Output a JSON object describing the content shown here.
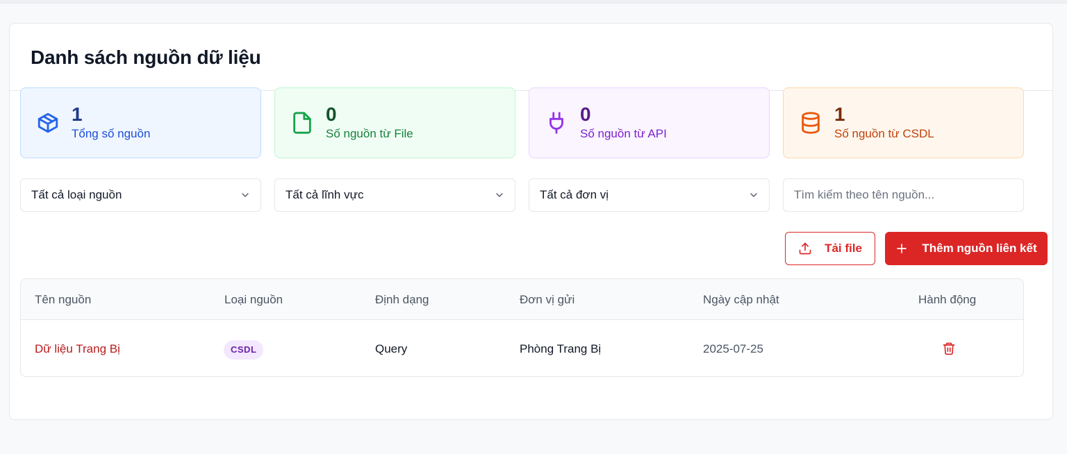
{
  "page": {
    "title": "Danh sách nguồn dữ liệu"
  },
  "stats": [
    {
      "value": "1",
      "label": "Tổng số nguồn",
      "icon": "box-icon",
      "color": "#2563eb"
    },
    {
      "value": "0",
      "label": "Số nguồn từ File",
      "icon": "file-icon",
      "color": "#16a34a"
    },
    {
      "value": "0",
      "label": "Số nguồn từ API",
      "icon": "plug-icon",
      "color": "#9333ea"
    },
    {
      "value": "1",
      "label": "Số nguồn từ CSDL",
      "icon": "database-icon",
      "color": "#ea580c"
    }
  ],
  "filters": {
    "type_select": "Tất cả loại nguồn",
    "field_select": "Tất cả lĩnh vực",
    "unit_select": "Tất cả đơn vị",
    "search_placeholder": "Tìm kiếm theo tên nguồn..."
  },
  "actions": {
    "upload_label": "Tải file",
    "add_label": "Thêm nguồn liên kết"
  },
  "table": {
    "columns": [
      "Tên nguồn",
      "Loại nguồn",
      "Định dạng",
      "Đơn vị gửi",
      "Ngày cập nhật",
      "Hành động"
    ],
    "rows": [
      {
        "name": "Dữ liệu Trang Bị",
        "type": "CSDL",
        "format": "Query",
        "unit": "Phòng Trang Bị",
        "updated": "2025-07-25"
      }
    ]
  },
  "colors": {
    "accent": "#dc2626",
    "badge_bg": "#f3e8ff",
    "badge_text": "#6b21a8"
  }
}
